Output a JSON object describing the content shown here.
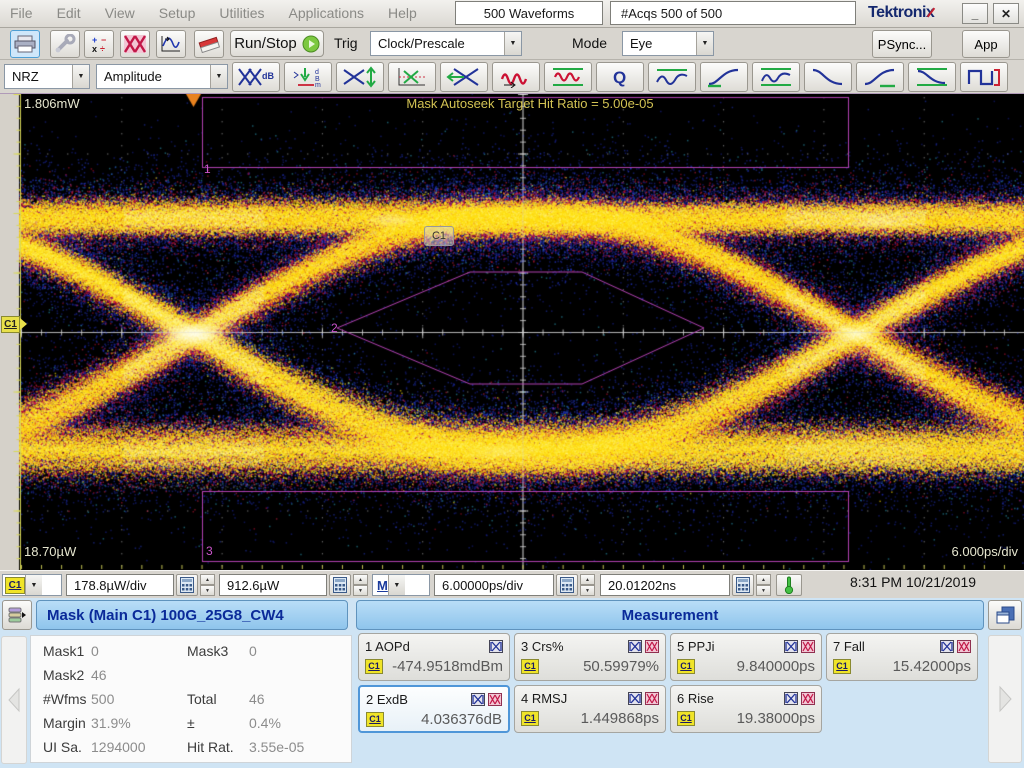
{
  "titlebar": {
    "menus": [
      "File",
      "Edit",
      "View",
      "Setup",
      "Utilities",
      "Applications",
      "Help"
    ],
    "waveform_count": "500 Waveforms",
    "acq_count": "#Acqs  500 of 500",
    "brand": "Tektronix",
    "minimize_glyph": "_",
    "close_glyph": "✕"
  },
  "run_toolbar": {
    "icons": [
      "print",
      "setup",
      "math",
      "mask-test",
      "waveform-measure",
      "erase"
    ],
    "run_stop_label": "Run/Stop",
    "trig_label": "Trig",
    "trig_value": "Clock/Prescale",
    "mode_label": "Mode",
    "mode_value": "Eye",
    "psync_label": "PSync...",
    "app_label": "App"
  },
  "measure_toolbar": {
    "signal_type": "NRZ",
    "category": "Amplitude",
    "icons": [
      "extinction-ratio-db",
      "average-power-dbm",
      "eye-height",
      "crossing",
      "eye-width",
      "jitter-pp",
      "jitter-rms",
      "q-factor",
      "level-high",
      "rise-time",
      "level-mid",
      "fall-time",
      "rise-time-2",
      "fall-levels",
      "pulse-width"
    ]
  },
  "plot": {
    "top_amplitude": "1.806mW",
    "autoseek_banner": "Mask Autoseek Target Hit Ratio = 5.00e-05",
    "bottom_amplitude": "18.70µW",
    "timebase": "6.000ps/div",
    "mask1_label": "1",
    "mask2_label": "2",
    "mask3_label": "3",
    "channel_badge": "C1",
    "channel_marker": "C1"
  },
  "statusbar": {
    "channel": "C1",
    "vertical_scale": "178.8µW/div",
    "vertical_offset": "912.6µW",
    "timebase_source": "M",
    "horizontal_scale": "6.00000ps/div",
    "horizontal_position": "20.01202ns",
    "datetime": "8:31 PM 10/21/2019"
  },
  "mask_panel": {
    "title": "Mask (Main  C1) 100G_25G8_CW4",
    "stats": [
      {
        "label_a": "Mask1",
        "value_a": "0",
        "label_b": "Mask3",
        "value_b": "0"
      },
      {
        "label_a": "Mask2",
        "value_a": "46",
        "label_b": "",
        "value_b": ""
      },
      {
        "label_a": "#Wfms",
        "value_a": "500",
        "label_b": "Total",
        "value_b": "46"
      },
      {
        "label_a": "Margin",
        "value_a": "31.9%",
        "label_b": "±",
        "value_b": "0.4%"
      },
      {
        "label_a": "UI Sa.",
        "value_a": "1294000",
        "label_b": "Hit Rat.",
        "value_b": "3.55e-05"
      }
    ]
  },
  "measurement_panel": {
    "title": "Measurement",
    "cells": [
      {
        "label": "1 AOPd",
        "source": "C1",
        "value": "-474.9518mdBm"
      },
      {
        "label": "3 Crs%",
        "source": "C1",
        "value": "50.59979%"
      },
      {
        "label": "5 PPJi",
        "source": "C1",
        "value": "9.840000ps"
      },
      {
        "label": "7 Fall",
        "source": "C1",
        "value": "15.42000ps"
      },
      {
        "label": "2 ExdB",
        "source": "C1",
        "value": "4.036376dB"
      },
      {
        "label": "4 RMSJ",
        "source": "C1",
        "value": "1.449868ps"
      },
      {
        "label": "6 Rise",
        "source": "C1",
        "value": "19.38000ps"
      }
    ]
  }
}
